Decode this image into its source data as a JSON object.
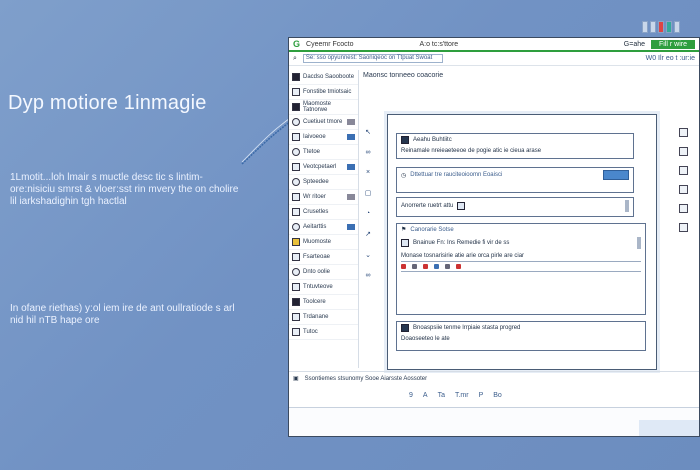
{
  "promo": {
    "title": "Dyp motiore 1inmagie",
    "description": "1Lmotit...loh lmair s muctle desc tic s lintim-ore:nisiciu smrst & vloer:sst rin mvery the on cholire lil iarkshadighin tgh hactlal",
    "note": "In ofane riethas) y:ol iem ire de ant oullratiode s arl nid hil nTB hape ore"
  },
  "window": {
    "logo": "G",
    "title": "Cyeemr Fcocto",
    "center_title": "A:o tc:s'ttore",
    "right_label": "G=ahe",
    "tab_label": "Fill r wire",
    "search_placeholder": "Se: sso opyunnest: Saoniqeoc on Ttpuat Swoat",
    "help_text": "W0 Ilr eo t :ur:ie"
  },
  "sidebar": {
    "items": [
      {
        "label": "Dacdso Saooboote",
        "icon": "folder-icon"
      },
      {
        "label": "Fonstibe tmiotsaic",
        "icon": "document-icon"
      },
      {
        "label": "Maomoste Tatnorwe",
        "icon": "mail-icon"
      },
      {
        "label": "Cuetiuet tmore",
        "icon": "chat-icon"
      },
      {
        "label": "Iaivoeoe",
        "icon": "user-icon"
      },
      {
        "label": "Ttetoe",
        "icon": "clock-icon"
      },
      {
        "label": "Veotcpetaerl",
        "icon": "camera-icon"
      },
      {
        "label": "Spteedee",
        "icon": "settings-icon"
      },
      {
        "label": "Wr ritoer",
        "icon": "star-icon"
      },
      {
        "label": "Crusetles",
        "icon": "people-icon"
      },
      {
        "label": "Aeitarttis",
        "icon": "globe-icon"
      },
      {
        "label": "Muomoste",
        "icon": "edit-icon"
      },
      {
        "label": "Fsarteoae",
        "icon": "grid-icon"
      },
      {
        "label": "Dnto oolie",
        "icon": "archive-icon"
      },
      {
        "label": "Tntuvteove",
        "icon": "calendar-icon"
      },
      {
        "label": "Toolcere",
        "icon": "tool-icon"
      },
      {
        "label": "Trdanane",
        "icon": "list-icon"
      },
      {
        "label": "Tutoc",
        "icon": "bookmark-icon"
      }
    ]
  },
  "panel_header": "Maonsc tonneeo coacorie",
  "dialog": {
    "card1": {
      "title": "Aeahu Buhtiitc",
      "line": "Reinamale nreieaeteeoe de pogie atic ie cieua arase"
    },
    "card2": {
      "label": "Dttettuar tre rauciteoioomn Eoaisci"
    },
    "card3": {
      "label": "Anorrerte ruetrt attu"
    },
    "card4": {
      "header": "Canorarie Sotse",
      "title": "Bnainue Fn: Ins Remedie fi vir de ss",
      "line": "Monase tosnarisirie atie arie orca pirle are ciar"
    },
    "card5": {
      "title": "Bnoaspsiie tenme lrrpiaie stasta progred",
      "line": "Doaoseeteo le ate"
    }
  },
  "statusbar": {
    "label": "Ssontiemes stsunomy Sooe Aiarsste Aossoter"
  },
  "formatbar": {
    "items": [
      "9",
      "A",
      "Ta",
      "T.mr",
      "P",
      "Bo"
    ]
  }
}
